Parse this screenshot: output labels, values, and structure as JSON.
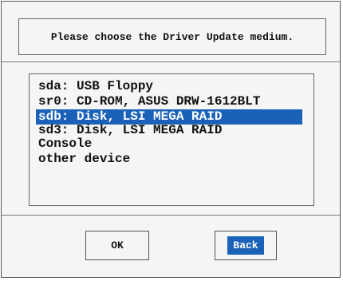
{
  "dialog": {
    "prompt": "Please choose the Driver Update medium."
  },
  "device_list": {
    "items": [
      {
        "label": "sda: USB Floppy",
        "selected": false
      },
      {
        "label": "sr0: CD-ROM, ASUS DRW-1612BLT",
        "selected": false
      },
      {
        "label": "sdb: Disk, LSI MEGA RAID",
        "selected": true
      },
      {
        "label": "sd3: Disk, LSI MEGA RAID",
        "selected": false
      },
      {
        "label": "Console",
        "selected": false
      },
      {
        "label": "other device",
        "selected": false
      }
    ]
  },
  "buttons": {
    "ok_label": "OK",
    "back_label": "Back"
  },
  "colors": {
    "highlight": "#1a62b8",
    "background": "#f5f5f5"
  }
}
